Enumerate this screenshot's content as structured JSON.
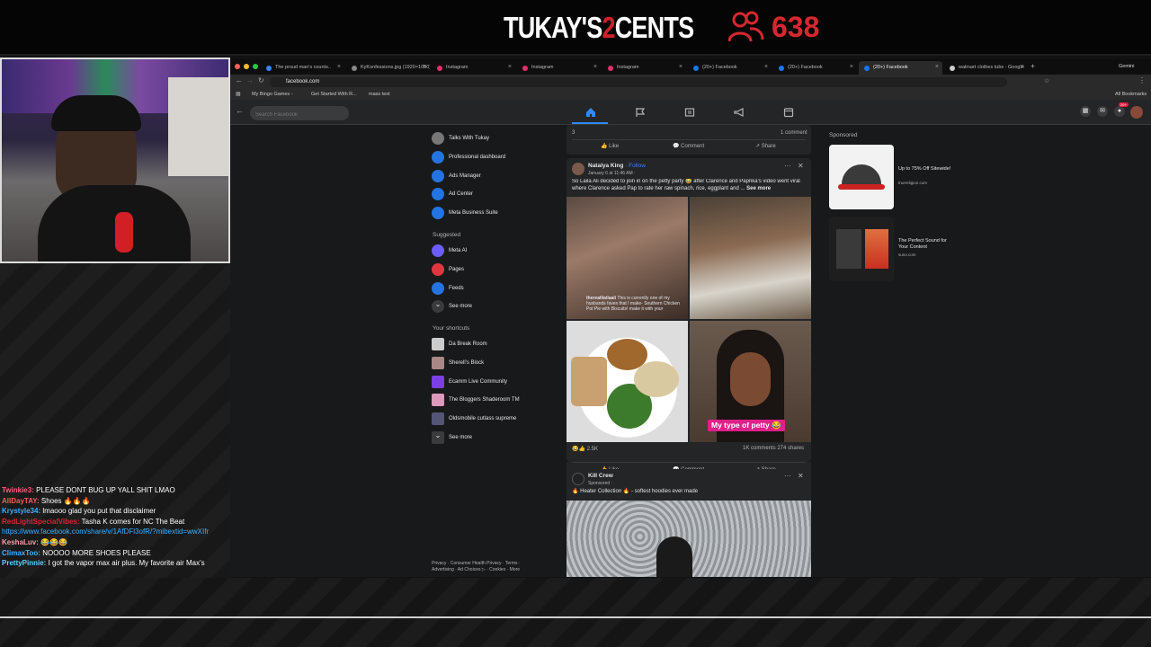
{
  "stream": {
    "title_a": "TUKAY'S",
    "title_b": "2",
    "title_c": "CENTS",
    "viewer_count": "638",
    "accent": "#d6282f"
  },
  "chat": [
    {
      "user": "Twinkie3:",
      "text": "PLEASE DONT BUG UP YALL SHIT LMAO",
      "color": "#ff5a7a"
    },
    {
      "user": "AllDayTAY:",
      "text": "Shoes 🔥🔥🔥",
      "color": "#ff5a5a"
    },
    {
      "user": "Krystyle34:",
      "text": "lmaooo glad you put that disclaimer",
      "color": "#3fb0ff"
    },
    {
      "user": "RedLightSpecialVibes:",
      "text": "Tasha K comes for NC The Beat",
      "color": "#d6282f"
    },
    {
      "user": "",
      "text": "https://www.facebook.com/share/v/1AfDFl3ofR/?mibextid=wwXIfr",
      "color": "#3fb0ff"
    },
    {
      "user": "KeshaLuv:",
      "text": "😂😂😂",
      "color": "#ff9aa8"
    },
    {
      "user": "ClimaxToo:",
      "text": "NOOOO MORE SHOES PLEASE",
      "color": "#3fb0ff"
    },
    {
      "user": "PrettyPinnie:",
      "text": "I got the vapor max air plus. My favorite air Max's",
      "color": "#5ad1ff"
    }
  ],
  "browser": {
    "tabs": [
      {
        "label": "The proud man's counts..",
        "color": "#3b82f6"
      },
      {
        "label": "KyKonfessions.jpg (1920×1080)",
        "color": "#888"
      },
      {
        "label": "Instagram",
        "color": "#e1306c"
      },
      {
        "label": "Instagram",
        "color": "#e1306c"
      },
      {
        "label": "Instagram",
        "color": "#e1306c"
      },
      {
        "label": "(20+) Facebook",
        "color": "#1877f2"
      },
      {
        "label": "(20+) Facebook",
        "color": "#1877f2"
      },
      {
        "label": "(20+) Facebook",
        "color": "#1877f2"
      },
      {
        "label": "walmart clothes tubs - Google",
        "color": "#ccc"
      }
    ],
    "gemini": "Gemini",
    "url": "facebook.com",
    "bookmarks": [
      "My Bingo Games -",
      "Get Started With R...",
      "mass text"
    ],
    "all_bookmarks": "All Bookmarks"
  },
  "facebook": {
    "search_placeholder": "Search Facebook",
    "notif_badge": "20+",
    "sidebar": [
      {
        "label": "Talks With Tukay",
        "icon": "page-avatar-icon",
        "color": "#777"
      },
      {
        "label": "Professional dashboard",
        "icon": "dashboard-icon",
        "color": "#2374e1"
      },
      {
        "label": "Ads Manager",
        "icon": "ads-manager-icon",
        "color": "#2374e1"
      },
      {
        "label": "Ad Center",
        "icon": "megaphone-icon",
        "color": "#2374e1"
      },
      {
        "label": "Meta Business Suite",
        "icon": "business-suite-icon",
        "color": "#2374e1"
      }
    ],
    "suggested_label": "Suggested",
    "suggested": [
      {
        "label": "Meta AI",
        "icon": "meta-ai-icon",
        "color": "#6a5cff"
      },
      {
        "label": "Pages",
        "icon": "flag-icon",
        "color": "#e0373f"
      },
      {
        "label": "Feeds",
        "icon": "feeds-icon",
        "color": "#2374e1"
      },
      {
        "label": "See more",
        "icon": "chevron-down-icon",
        "color": "#3a3b3c"
      }
    ],
    "shortcuts_label": "Your shortcuts",
    "shortcuts": [
      {
        "label": "Da Break Room",
        "color": "#ccc"
      },
      {
        "label": "Sherell's Block",
        "color": "#a88"
      },
      {
        "label": "Ecamm Live Community",
        "color": "#7b3fe4"
      },
      {
        "label": "The Bloggers Shaderoom TM",
        "color": "#d9b"
      },
      {
        "label": "Oldsmobile cutlass supreme",
        "color": "#557"
      },
      {
        "label": "See more",
        "color": "#3a3b3c"
      }
    ],
    "prev_post": {
      "reactions": "3",
      "comments": "1 comment",
      "like": "Like",
      "comment": "Comment",
      "share": "Share"
    },
    "post1": {
      "author": "Natalya King",
      "follow": "Follow",
      "time": "January 6 at 11:46 AM · ",
      "text": "So Laila Ali decided to join in on the petty party 😂 after Clarence and Paprika's video went viral where Clarence asked Pap to rate her raw spinach, rice, eggplant and ...",
      "see_more": "See more",
      "overlay_user": "therealilailaali",
      "overlay_text": "This is currently one of my husbands faves that I make- Southern Chicken Pot Pie with Biscuits! make it with your",
      "sticker": "My type of petty 😂",
      "reactions": "2.5K",
      "stats": "1K comments  274 shares",
      "like": "Like",
      "comment": "Comment",
      "share": "Share"
    },
    "post2": {
      "author": "Kill Crew",
      "sponsored": "Sponsored · ",
      "text": "🔥 Heater Collection 🔥 - softest hoodies ever made"
    },
    "sponsored_label": "Sponsored",
    "ads": [
      {
        "title": "Up to 75% Off Sitewide!",
        "domain": "truereligion.com"
      },
      {
        "title": "The Perfect Sound for Your Content",
        "domain": "suno.com"
      }
    ],
    "footer": "Privacy · Consumer Health Privacy · Terms · Advertising · Ad Choices ▷ · Cookies · More"
  }
}
